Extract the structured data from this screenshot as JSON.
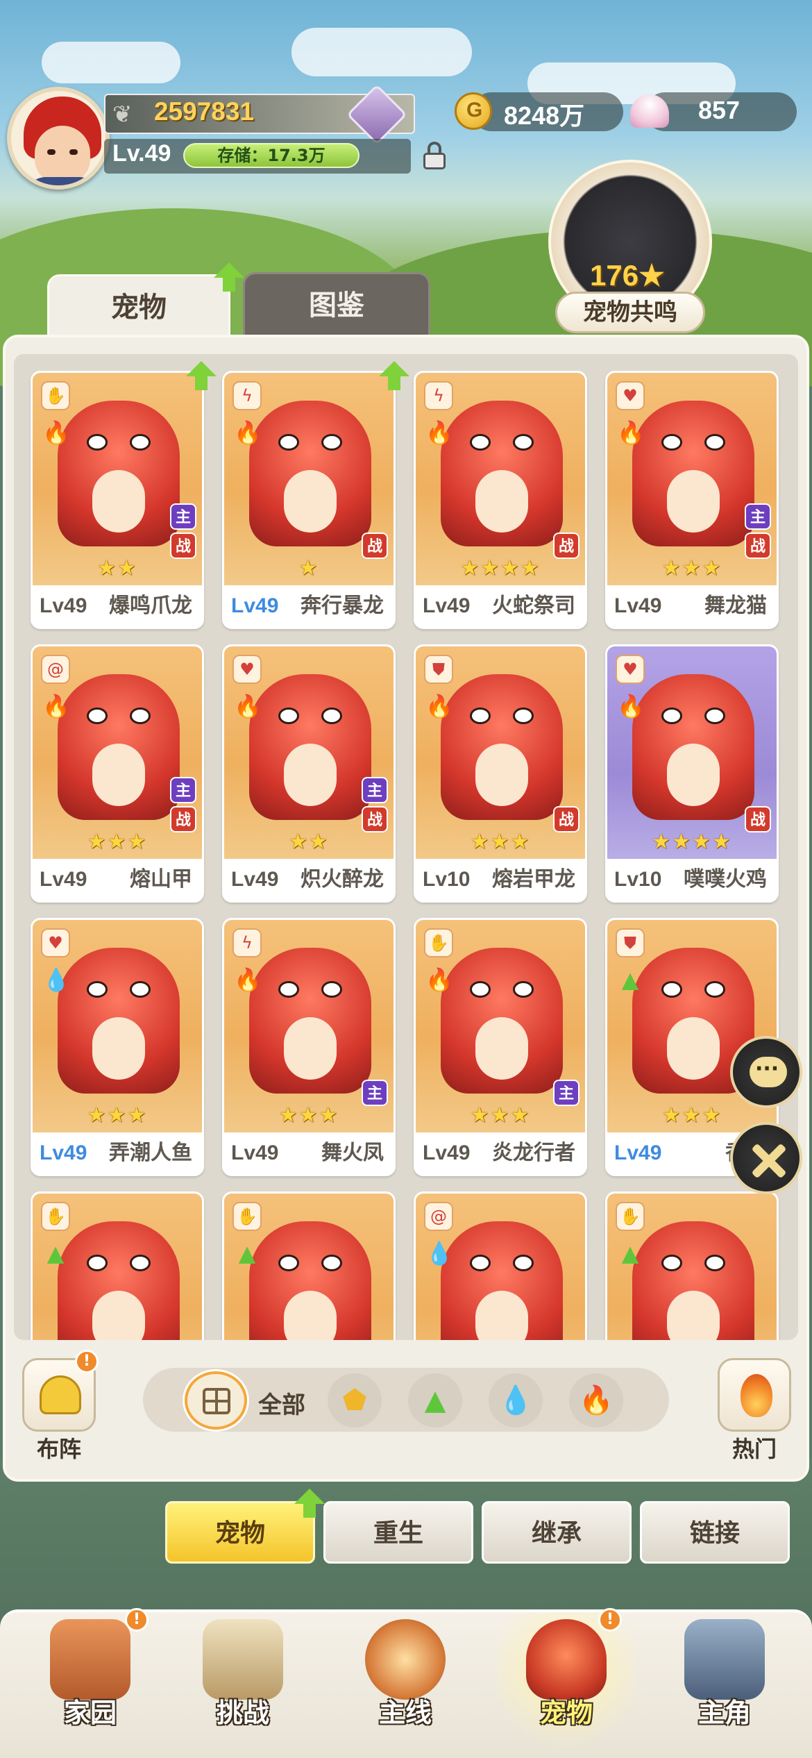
{
  "player": {
    "power": "2597831",
    "level": "Lv.49",
    "storage": "存储：17.3万"
  },
  "currency": {
    "gold": "8248万",
    "shells": "857"
  },
  "resonance": {
    "value": "176",
    "label": "宠物共鸣"
  },
  "tabs": {
    "pets": "宠物",
    "codex": "图鉴"
  },
  "pets": [
    {
      "level": "Lv49",
      "name": "爆鸣爪龙",
      "stars": "★★",
      "level_color": "gray",
      "type_icon": "claw-icon",
      "element": "fire",
      "tags": [
        "主",
        "战"
      ],
      "upgrade": true
    },
    {
      "level": "Lv49",
      "name": "奔行暴龙",
      "stars": "★",
      "level_color": "blue",
      "type_icon": "bolt-icon",
      "element": "fire",
      "tags": [
        "战"
      ],
      "upgrade": true
    },
    {
      "level": "Lv49",
      "name": "火蛇祭司",
      "stars": "★★★★",
      "level_color": "gray",
      "type_icon": "bolt-icon",
      "element": "fire",
      "tags": [
        "战"
      ],
      "upgrade": false
    },
    {
      "level": "Lv49",
      "name": "舞龙猫",
      "stars": "★★★",
      "level_color": "gray",
      "type_icon": "heart-icon",
      "element": "fire",
      "tags": [
        "主",
        "战"
      ],
      "upgrade": false
    },
    {
      "level": "Lv49",
      "name": "熔山甲",
      "stars": "★★★",
      "level_color": "gray",
      "type_icon": "swirl-icon",
      "element": "fire",
      "tags": [
        "主",
        "战"
      ],
      "upgrade": false
    },
    {
      "level": "Lv49",
      "name": "炽火醉龙",
      "stars": "★★",
      "level_color": "gray",
      "type_icon": "heart-icon",
      "element": "fire",
      "tags": [
        "主",
        "战"
      ],
      "upgrade": false
    },
    {
      "level": "Lv10",
      "name": "熔岩甲龙",
      "stars": "★★★",
      "level_color": "gray",
      "type_icon": "shield-icon",
      "element": "fire",
      "tags": [
        "战"
      ],
      "upgrade": false
    },
    {
      "level": "Lv10",
      "name": "噗噗火鸡",
      "stars": "★★★★",
      "level_color": "gray",
      "type_icon": "heart-icon",
      "element": "fire",
      "tags": [
        "战"
      ],
      "upgrade": false,
      "purple": true
    },
    {
      "level": "Lv49",
      "name": "弄潮人鱼",
      "stars": "★★★",
      "level_color": "blue",
      "type_icon": "heart-icon",
      "element": "water",
      "tags": [],
      "upgrade": false
    },
    {
      "level": "Lv49",
      "name": "舞火凤",
      "stars": "★★★",
      "level_color": "gray",
      "type_icon": "bolt-icon",
      "element": "fire",
      "tags": [
        "主"
      ],
      "upgrade": false
    },
    {
      "level": "Lv49",
      "name": "炎龙行者",
      "stars": "★★★",
      "level_color": "gray",
      "type_icon": "claw-icon",
      "element": "fire",
      "tags": [
        "主"
      ],
      "upgrade": false
    },
    {
      "level": "Lv49",
      "name": "香蕉",
      "stars": "★★★",
      "level_color": "blue",
      "type_icon": "shield-icon",
      "element": "grass",
      "tags": [],
      "upgrade": false
    },
    {
      "level": "",
      "name": "",
      "stars": "",
      "level_color": "gray",
      "type_icon": "claw-icon",
      "element": "grass",
      "tags": [],
      "upgrade": false
    },
    {
      "level": "",
      "name": "",
      "stars": "",
      "level_color": "gray",
      "type_icon": "claw-icon",
      "element": "grass",
      "tags": [],
      "upgrade": false
    },
    {
      "level": "",
      "name": "",
      "stars": "",
      "level_color": "gray",
      "type_icon": "swirl-icon",
      "element": "water",
      "tags": [],
      "upgrade": false
    },
    {
      "level": "",
      "name": "",
      "stars": "",
      "level_color": "gray",
      "type_icon": "claw-icon",
      "element": "grass",
      "tags": [],
      "upgrade": false
    }
  ],
  "filter": {
    "team_label": "布阵",
    "team_badge": "!",
    "all_label": "全部",
    "hot_label": "热门"
  },
  "subtabs": [
    "宠物",
    "重生",
    "继承",
    "链接"
  ],
  "nav": [
    {
      "label": "家园",
      "badge": "!"
    },
    {
      "label": "挑战",
      "badge": ""
    },
    {
      "label": "主线",
      "badge": ""
    },
    {
      "label": "宠物",
      "badge": "!"
    },
    {
      "label": "主角",
      "badge": ""
    }
  ],
  "colors": {
    "accent": "#f4c42b",
    "level_blue": "#3f8be0",
    "upgrade_green": "#7fd23a",
    "tag_main": "#6d3fc0",
    "tag_battle": "#d23a2c"
  }
}
